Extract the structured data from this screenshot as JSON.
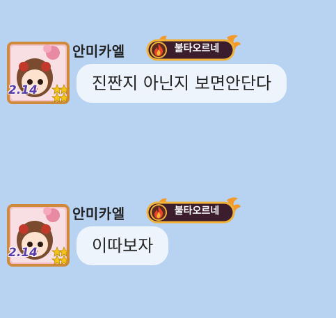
{
  "messages": [
    {
      "sender": "안미카엘",
      "badge": "불타오르네",
      "avatar_level": "2.14",
      "text": "진짠지 아닌지 보면안단다"
    },
    {
      "sender": "안미카엘",
      "badge": "불타오르네",
      "avatar_level": "2.14",
      "text": "이따보자"
    }
  ],
  "colors": {
    "background": "#b8d3f2",
    "bubble": "#eef4fb",
    "badge_bg": "#3b1d2e",
    "badge_border": "#f0b23a",
    "flame": "#e8452a"
  }
}
